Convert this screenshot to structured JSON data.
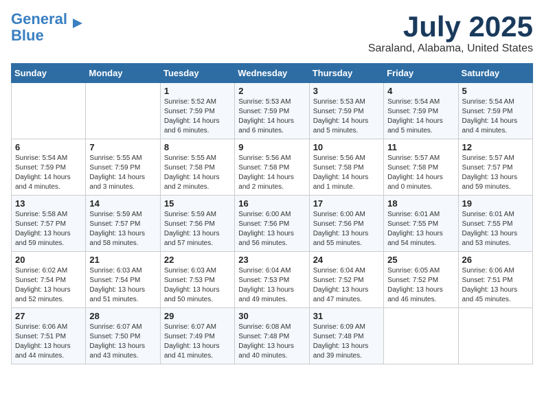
{
  "logo": {
    "line1": "General",
    "line2": "Blue"
  },
  "title": "July 2025",
  "location": "Saraland, Alabama, United States",
  "weekdays": [
    "Sunday",
    "Monday",
    "Tuesday",
    "Wednesday",
    "Thursday",
    "Friday",
    "Saturday"
  ],
  "weeks": [
    [
      {
        "day": "",
        "info": ""
      },
      {
        "day": "",
        "info": ""
      },
      {
        "day": "1",
        "info": "Sunrise: 5:52 AM\nSunset: 7:59 PM\nDaylight: 14 hours\nand 6 minutes."
      },
      {
        "day": "2",
        "info": "Sunrise: 5:53 AM\nSunset: 7:59 PM\nDaylight: 14 hours\nand 6 minutes."
      },
      {
        "day": "3",
        "info": "Sunrise: 5:53 AM\nSunset: 7:59 PM\nDaylight: 14 hours\nand 5 minutes."
      },
      {
        "day": "4",
        "info": "Sunrise: 5:54 AM\nSunset: 7:59 PM\nDaylight: 14 hours\nand 5 minutes."
      },
      {
        "day": "5",
        "info": "Sunrise: 5:54 AM\nSunset: 7:59 PM\nDaylight: 14 hours\nand 4 minutes."
      }
    ],
    [
      {
        "day": "6",
        "info": "Sunrise: 5:54 AM\nSunset: 7:59 PM\nDaylight: 14 hours\nand 4 minutes."
      },
      {
        "day": "7",
        "info": "Sunrise: 5:55 AM\nSunset: 7:59 PM\nDaylight: 14 hours\nand 3 minutes."
      },
      {
        "day": "8",
        "info": "Sunrise: 5:55 AM\nSunset: 7:58 PM\nDaylight: 14 hours\nand 2 minutes."
      },
      {
        "day": "9",
        "info": "Sunrise: 5:56 AM\nSunset: 7:58 PM\nDaylight: 14 hours\nand 2 minutes."
      },
      {
        "day": "10",
        "info": "Sunrise: 5:56 AM\nSunset: 7:58 PM\nDaylight: 14 hours\nand 1 minute."
      },
      {
        "day": "11",
        "info": "Sunrise: 5:57 AM\nSunset: 7:58 PM\nDaylight: 14 hours\nand 0 minutes."
      },
      {
        "day": "12",
        "info": "Sunrise: 5:57 AM\nSunset: 7:57 PM\nDaylight: 13 hours\nand 59 minutes."
      }
    ],
    [
      {
        "day": "13",
        "info": "Sunrise: 5:58 AM\nSunset: 7:57 PM\nDaylight: 13 hours\nand 59 minutes."
      },
      {
        "day": "14",
        "info": "Sunrise: 5:59 AM\nSunset: 7:57 PM\nDaylight: 13 hours\nand 58 minutes."
      },
      {
        "day": "15",
        "info": "Sunrise: 5:59 AM\nSunset: 7:56 PM\nDaylight: 13 hours\nand 57 minutes."
      },
      {
        "day": "16",
        "info": "Sunrise: 6:00 AM\nSunset: 7:56 PM\nDaylight: 13 hours\nand 56 minutes."
      },
      {
        "day": "17",
        "info": "Sunrise: 6:00 AM\nSunset: 7:56 PM\nDaylight: 13 hours\nand 55 minutes."
      },
      {
        "day": "18",
        "info": "Sunrise: 6:01 AM\nSunset: 7:55 PM\nDaylight: 13 hours\nand 54 minutes."
      },
      {
        "day": "19",
        "info": "Sunrise: 6:01 AM\nSunset: 7:55 PM\nDaylight: 13 hours\nand 53 minutes."
      }
    ],
    [
      {
        "day": "20",
        "info": "Sunrise: 6:02 AM\nSunset: 7:54 PM\nDaylight: 13 hours\nand 52 minutes."
      },
      {
        "day": "21",
        "info": "Sunrise: 6:03 AM\nSunset: 7:54 PM\nDaylight: 13 hours\nand 51 minutes."
      },
      {
        "day": "22",
        "info": "Sunrise: 6:03 AM\nSunset: 7:53 PM\nDaylight: 13 hours\nand 50 minutes."
      },
      {
        "day": "23",
        "info": "Sunrise: 6:04 AM\nSunset: 7:53 PM\nDaylight: 13 hours\nand 49 minutes."
      },
      {
        "day": "24",
        "info": "Sunrise: 6:04 AM\nSunset: 7:52 PM\nDaylight: 13 hours\nand 47 minutes."
      },
      {
        "day": "25",
        "info": "Sunrise: 6:05 AM\nSunset: 7:52 PM\nDaylight: 13 hours\nand 46 minutes."
      },
      {
        "day": "26",
        "info": "Sunrise: 6:06 AM\nSunset: 7:51 PM\nDaylight: 13 hours\nand 45 minutes."
      }
    ],
    [
      {
        "day": "27",
        "info": "Sunrise: 6:06 AM\nSunset: 7:51 PM\nDaylight: 13 hours\nand 44 minutes."
      },
      {
        "day": "28",
        "info": "Sunrise: 6:07 AM\nSunset: 7:50 PM\nDaylight: 13 hours\nand 43 minutes."
      },
      {
        "day": "29",
        "info": "Sunrise: 6:07 AM\nSunset: 7:49 PM\nDaylight: 13 hours\nand 41 minutes."
      },
      {
        "day": "30",
        "info": "Sunrise: 6:08 AM\nSunset: 7:48 PM\nDaylight: 13 hours\nand 40 minutes."
      },
      {
        "day": "31",
        "info": "Sunrise: 6:09 AM\nSunset: 7:48 PM\nDaylight: 13 hours\nand 39 minutes."
      },
      {
        "day": "",
        "info": ""
      },
      {
        "day": "",
        "info": ""
      }
    ]
  ]
}
